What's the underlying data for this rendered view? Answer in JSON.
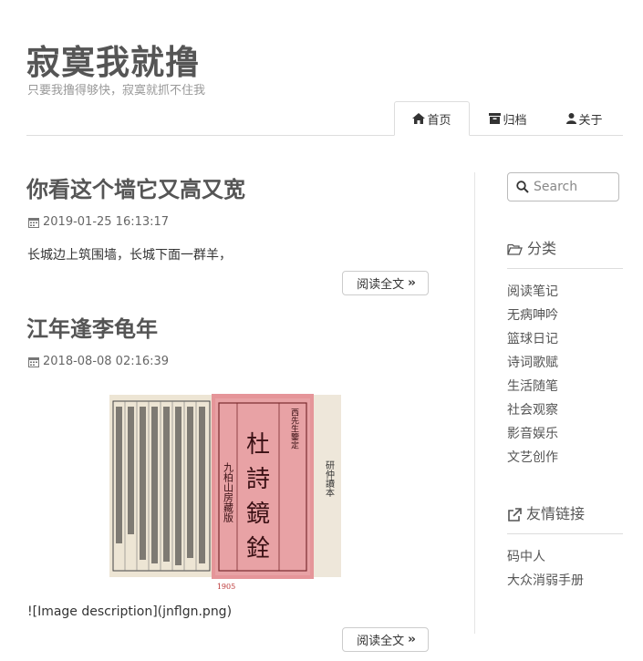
{
  "header": {
    "title": "寂寞我就撸",
    "description": "只要我撸得够快，寂寞就抓不住我"
  },
  "nav": {
    "home": "首页",
    "archive": "归档",
    "about": "关于"
  },
  "posts": [
    {
      "title": "你看这个墙它又高又宽",
      "date": "2019-01-25 16:13:17",
      "excerpt": "长城边上筑围墙，长城下面一群羊，",
      "read_more": "阅读全文"
    },
    {
      "title": "江年逢李龟年",
      "date": "2018-08-08 02:16:39",
      "excerpt": "![Image description](jnflgn.png)",
      "read_more": "阅读全文",
      "image": {
        "cover_title": "杜詩鏡銓",
        "side_label": "研仲讀本",
        "stamp_text": "九柏山房藏版",
        "top_text": "西先生鑒定",
        "caption": "1905"
      }
    }
  ],
  "sidebar": {
    "search_placeholder": "Search",
    "categories_title": "分类",
    "categories": [
      "阅读笔记",
      "无病呻吟",
      "篮球日记",
      "诗词歌赋",
      "生活随笔",
      "社会观察",
      "影音娱乐",
      "文艺创作"
    ],
    "links_title": "友情链接",
    "links": [
      "码中人",
      "大众消弱手册"
    ]
  }
}
